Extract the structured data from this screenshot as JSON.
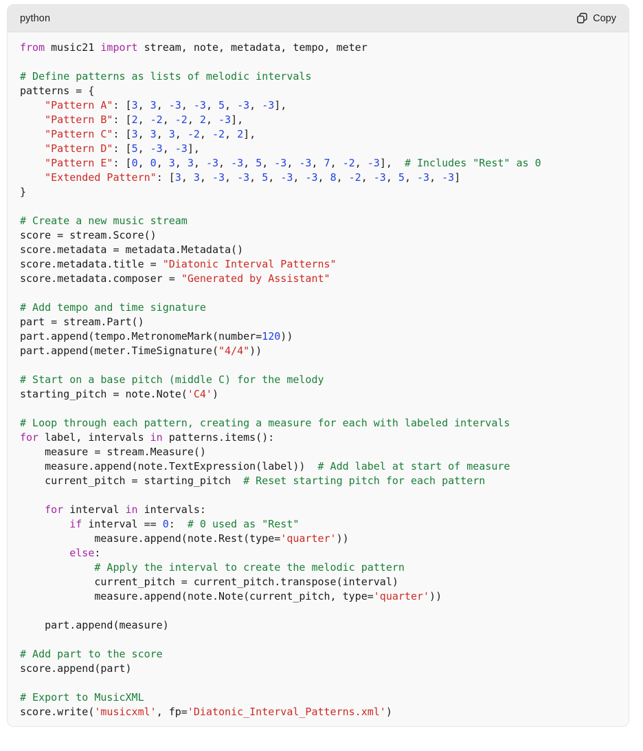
{
  "code_block": {
    "language_label": "python",
    "copy_label": "Copy",
    "copy_icon": "copy-icon",
    "colors": {
      "header_background": "#e9e9e9",
      "code_background": "#f9f9f9",
      "border": "#e6e6e6",
      "keyword": "#a626a4",
      "string": "#cc2a24",
      "number": "#2040e0",
      "comment": "#1a7f37",
      "plain_text": "#1b1b1b",
      "scrollbar_thumb": "#c4c4c4"
    },
    "scroll": {
      "horizontal": true,
      "thumb_fraction": 0.49
    },
    "lines": [
      [
        [
          "k",
          "from"
        ],
        [
          "p",
          " music21 "
        ],
        [
          "k",
          "import"
        ],
        [
          "p",
          " stream, note, metadata, tempo, meter"
        ]
      ],
      [],
      [
        [
          "c",
          "# Define patterns as lists of melodic intervals"
        ]
      ],
      [
        [
          "p",
          "patterns = {"
        ]
      ],
      [
        [
          "p",
          "    "
        ],
        [
          "s",
          "\"Pattern A\""
        ],
        [
          "p",
          ": ["
        ],
        [
          "n",
          "3"
        ],
        [
          "p",
          ", "
        ],
        [
          "n",
          "3"
        ],
        [
          "p",
          ", "
        ],
        [
          "n",
          "-3"
        ],
        [
          "p",
          ", "
        ],
        [
          "n",
          "-3"
        ],
        [
          "p",
          ", "
        ],
        [
          "n",
          "5"
        ],
        [
          "p",
          ", "
        ],
        [
          "n",
          "-3"
        ],
        [
          "p",
          ", "
        ],
        [
          "n",
          "-3"
        ],
        [
          "p",
          "],"
        ]
      ],
      [
        [
          "p",
          "    "
        ],
        [
          "s",
          "\"Pattern B\""
        ],
        [
          "p",
          ": ["
        ],
        [
          "n",
          "2"
        ],
        [
          "p",
          ", "
        ],
        [
          "n",
          "-2"
        ],
        [
          "p",
          ", "
        ],
        [
          "n",
          "-2"
        ],
        [
          "p",
          ", "
        ],
        [
          "n",
          "2"
        ],
        [
          "p",
          ", "
        ],
        [
          "n",
          "-3"
        ],
        [
          "p",
          "],"
        ]
      ],
      [
        [
          "p",
          "    "
        ],
        [
          "s",
          "\"Pattern C\""
        ],
        [
          "p",
          ": ["
        ],
        [
          "n",
          "3"
        ],
        [
          "p",
          ", "
        ],
        [
          "n",
          "3"
        ],
        [
          "p",
          ", "
        ],
        [
          "n",
          "3"
        ],
        [
          "p",
          ", "
        ],
        [
          "n",
          "-2"
        ],
        [
          "p",
          ", "
        ],
        [
          "n",
          "-2"
        ],
        [
          "p",
          ", "
        ],
        [
          "n",
          "2"
        ],
        [
          "p",
          "],"
        ]
      ],
      [
        [
          "p",
          "    "
        ],
        [
          "s",
          "\"Pattern D\""
        ],
        [
          "p",
          ": ["
        ],
        [
          "n",
          "5"
        ],
        [
          "p",
          ", "
        ],
        [
          "n",
          "-3"
        ],
        [
          "p",
          ", "
        ],
        [
          "n",
          "-3"
        ],
        [
          "p",
          "],"
        ]
      ],
      [
        [
          "p",
          "    "
        ],
        [
          "s",
          "\"Pattern E\""
        ],
        [
          "p",
          ": ["
        ],
        [
          "n",
          "0"
        ],
        [
          "p",
          ", "
        ],
        [
          "n",
          "0"
        ],
        [
          "p",
          ", "
        ],
        [
          "n",
          "3"
        ],
        [
          "p",
          ", "
        ],
        [
          "n",
          "3"
        ],
        [
          "p",
          ", "
        ],
        [
          "n",
          "-3"
        ],
        [
          "p",
          ", "
        ],
        [
          "n",
          "-3"
        ],
        [
          "p",
          ", "
        ],
        [
          "n",
          "5"
        ],
        [
          "p",
          ", "
        ],
        [
          "n",
          "-3"
        ],
        [
          "p",
          ", "
        ],
        [
          "n",
          "-3"
        ],
        [
          "p",
          ", "
        ],
        [
          "n",
          "7"
        ],
        [
          "p",
          ", "
        ],
        [
          "n",
          "-2"
        ],
        [
          "p",
          ", "
        ],
        [
          "n",
          "-3"
        ],
        [
          "p",
          "],  "
        ],
        [
          "c",
          "# Includes \"Rest\" as 0"
        ]
      ],
      [
        [
          "p",
          "    "
        ],
        [
          "s",
          "\"Extended Pattern\""
        ],
        [
          "p",
          ": ["
        ],
        [
          "n",
          "3"
        ],
        [
          "p",
          ", "
        ],
        [
          "n",
          "3"
        ],
        [
          "p",
          ", "
        ],
        [
          "n",
          "-3"
        ],
        [
          "p",
          ", "
        ],
        [
          "n",
          "-3"
        ],
        [
          "p",
          ", "
        ],
        [
          "n",
          "5"
        ],
        [
          "p",
          ", "
        ],
        [
          "n",
          "-3"
        ],
        [
          "p",
          ", "
        ],
        [
          "n",
          "-3"
        ],
        [
          "p",
          ", "
        ],
        [
          "n",
          "8"
        ],
        [
          "p",
          ", "
        ],
        [
          "n",
          "-2"
        ],
        [
          "p",
          ", "
        ],
        [
          "n",
          "-3"
        ],
        [
          "p",
          ", "
        ],
        [
          "n",
          "5"
        ],
        [
          "p",
          ", "
        ],
        [
          "n",
          "-3"
        ],
        [
          "p",
          ", "
        ],
        [
          "n",
          "-3"
        ],
        [
          "p",
          "]"
        ]
      ],
      [
        [
          "p",
          "}"
        ]
      ],
      [],
      [
        [
          "c",
          "# Create a new music stream"
        ]
      ],
      [
        [
          "p",
          "score = stream.Score()"
        ]
      ],
      [
        [
          "p",
          "score.metadata = metadata.Metadata()"
        ]
      ],
      [
        [
          "p",
          "score.metadata.title = "
        ],
        [
          "s",
          "\"Diatonic Interval Patterns\""
        ]
      ],
      [
        [
          "p",
          "score.metadata.composer = "
        ],
        [
          "s",
          "\"Generated by Assistant\""
        ]
      ],
      [],
      [
        [
          "c",
          "# Add tempo and time signature"
        ]
      ],
      [
        [
          "p",
          "part = stream.Part()"
        ]
      ],
      [
        [
          "p",
          "part.append(tempo.MetronomeMark(number="
        ],
        [
          "n",
          "120"
        ],
        [
          "p",
          "))"
        ]
      ],
      [
        [
          "p",
          "part.append(meter.TimeSignature("
        ],
        [
          "s",
          "\"4/4\""
        ],
        [
          "p",
          "))"
        ]
      ],
      [],
      [
        [
          "c",
          "# Start on a base pitch (middle C) for the melody"
        ]
      ],
      [
        [
          "p",
          "starting_pitch = note.Note("
        ],
        [
          "s",
          "'C4'"
        ],
        [
          "p",
          ")"
        ]
      ],
      [],
      [
        [
          "c",
          "# Loop through each pattern, creating a measure for each with labeled intervals"
        ]
      ],
      [
        [
          "k",
          "for"
        ],
        [
          "p",
          " label, intervals "
        ],
        [
          "k",
          "in"
        ],
        [
          "p",
          " patterns.items():"
        ]
      ],
      [
        [
          "p",
          "    measure = stream.Measure()"
        ]
      ],
      [
        [
          "p",
          "    measure.append(note.TextExpression(label))  "
        ],
        [
          "c",
          "# Add label at start of measure"
        ]
      ],
      [
        [
          "p",
          "    current_pitch = starting_pitch  "
        ],
        [
          "c",
          "# Reset starting pitch for each pattern"
        ]
      ],
      [],
      [
        [
          "p",
          "    "
        ],
        [
          "k",
          "for"
        ],
        [
          "p",
          " interval "
        ],
        [
          "k",
          "in"
        ],
        [
          "p",
          " intervals:"
        ]
      ],
      [
        [
          "p",
          "        "
        ],
        [
          "k",
          "if"
        ],
        [
          "p",
          " interval == "
        ],
        [
          "n",
          "0"
        ],
        [
          "p",
          ":  "
        ],
        [
          "c",
          "# 0 used as \"Rest\""
        ]
      ],
      [
        [
          "p",
          "            measure.append(note.Rest(type="
        ],
        [
          "s",
          "'quarter'"
        ],
        [
          "p",
          "))"
        ]
      ],
      [
        [
          "p",
          "        "
        ],
        [
          "k",
          "else"
        ],
        [
          "p",
          ":"
        ]
      ],
      [
        [
          "p",
          "            "
        ],
        [
          "c",
          "# Apply the interval to create the melodic pattern"
        ]
      ],
      [
        [
          "p",
          "            current_pitch = current_pitch.transpose(interval)"
        ]
      ],
      [
        [
          "p",
          "            measure.append(note.Note(current_pitch, type="
        ],
        [
          "s",
          "'quarter'"
        ],
        [
          "p",
          "))"
        ]
      ],
      [],
      [
        [
          "p",
          "    part.append(measure)"
        ]
      ],
      [],
      [
        [
          "c",
          "# Add part to the score"
        ]
      ],
      [
        [
          "p",
          "score.append(part)"
        ]
      ],
      [],
      [
        [
          "c",
          "# Export to MusicXML"
        ]
      ],
      [
        [
          "p",
          "score.write("
        ],
        [
          "s",
          "'musicxml'"
        ],
        [
          "p",
          ", fp="
        ],
        [
          "s",
          "'Diatonic_Interval_Patterns.xml'"
        ],
        [
          "p",
          ")"
        ]
      ]
    ]
  }
}
